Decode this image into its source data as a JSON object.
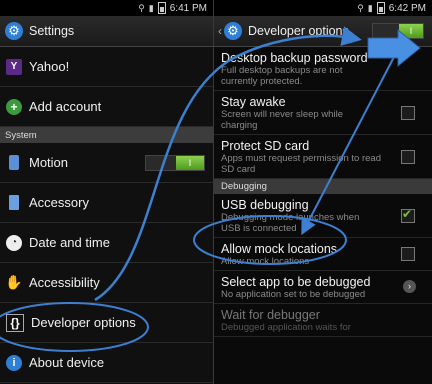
{
  "left": {
    "status_time": "6:41 PM",
    "title": "Settings",
    "items_top": [
      {
        "label": "Yahoo!",
        "icon": "yahoo-icon"
      },
      {
        "label": "Add account",
        "icon": "add-icon"
      }
    ],
    "section": "System",
    "items": [
      {
        "label": "Motion",
        "icon": "motion-icon"
      },
      {
        "label": "Accessory",
        "icon": "accessory-icon"
      },
      {
        "label": "Date and time",
        "icon": "clock-icon"
      },
      {
        "label": "Accessibility",
        "icon": "hand-icon"
      },
      {
        "label": "Developer options",
        "icon": "braces-icon"
      },
      {
        "label": "About device",
        "icon": "info-icon"
      }
    ],
    "motion_toggle": "I"
  },
  "right": {
    "status_time": "6:42 PM",
    "title": "Developer options",
    "master_toggle": "I",
    "items": [
      {
        "title": "Desktop backup password",
        "sub": "Full desktop backups are not currently protected."
      },
      {
        "title": "Stay awake",
        "sub": "Screen will never sleep while charging",
        "checked": false
      },
      {
        "title": "Protect SD card",
        "sub": "Apps must request permission to read SD card",
        "checked": false
      }
    ],
    "section": "Debugging",
    "items2": [
      {
        "title": "USB debugging",
        "sub": "Debugging mode launches when USB is connected",
        "checked": true
      },
      {
        "title": "Allow mock locations",
        "sub": "Allow mock locations",
        "checked": false
      },
      {
        "title": "Select app to be debugged",
        "sub": "No application set to be debugged"
      },
      {
        "title": "Wait for debugger",
        "sub": "Debugged application waits for"
      }
    ]
  },
  "colors": {
    "accent": "#2f7fd6",
    "annotation": "#3d7fd0",
    "toggle_on": "#6fbf2e"
  }
}
